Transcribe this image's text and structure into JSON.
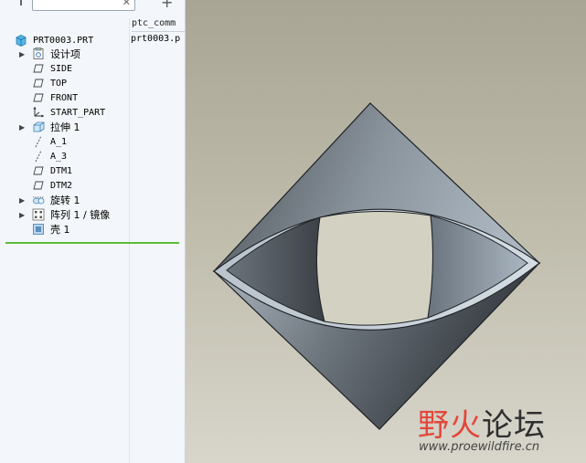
{
  "model_tree": {
    "search_value": "",
    "column_header": "ptc_comm",
    "root": {
      "label": "PRT0003.PRT",
      "file": "prt0003.p"
    },
    "items": [
      {
        "label": "设计项",
        "icon": "design-items-icon",
        "expandable": true
      },
      {
        "label": "SIDE",
        "icon": "datum-plane-icon",
        "expandable": false
      },
      {
        "label": "TOP",
        "icon": "datum-plane-icon",
        "expandable": false
      },
      {
        "label": "FRONT",
        "icon": "datum-plane-icon",
        "expandable": false
      },
      {
        "label": "START_PART",
        "icon": "coordinate-system-icon",
        "expandable": false
      },
      {
        "label": "拉伸 1",
        "icon": "extrude-icon",
        "expandable": true
      },
      {
        "label": "A_1",
        "icon": "datum-axis-icon",
        "expandable": false
      },
      {
        "label": "A_3",
        "icon": "datum-axis-icon",
        "expandable": false
      },
      {
        "label": "DTM1",
        "icon": "datum-plane-icon",
        "expandable": false
      },
      {
        "label": "DTM2",
        "icon": "datum-plane-icon",
        "expandable": false
      },
      {
        "label": "旋转 1",
        "icon": "revolve-icon",
        "expandable": true
      },
      {
        "label": "阵列 1 / 镜像",
        "icon": "pattern-icon",
        "expandable": true
      },
      {
        "label": "壳 1",
        "icon": "shell-icon",
        "expandable": false
      }
    ],
    "insert_indicator_color": "#5dbb3c"
  },
  "watermark": {
    "cn_red": "野火",
    "cn_dark": "论坛",
    "url": "www.proewildfire.cn"
  },
  "colors": {
    "background_top": "#a8a594",
    "background_bottom": "#d8d6cb",
    "model_light": "#a6b1bb",
    "model_dark": "#3c4146"
  }
}
